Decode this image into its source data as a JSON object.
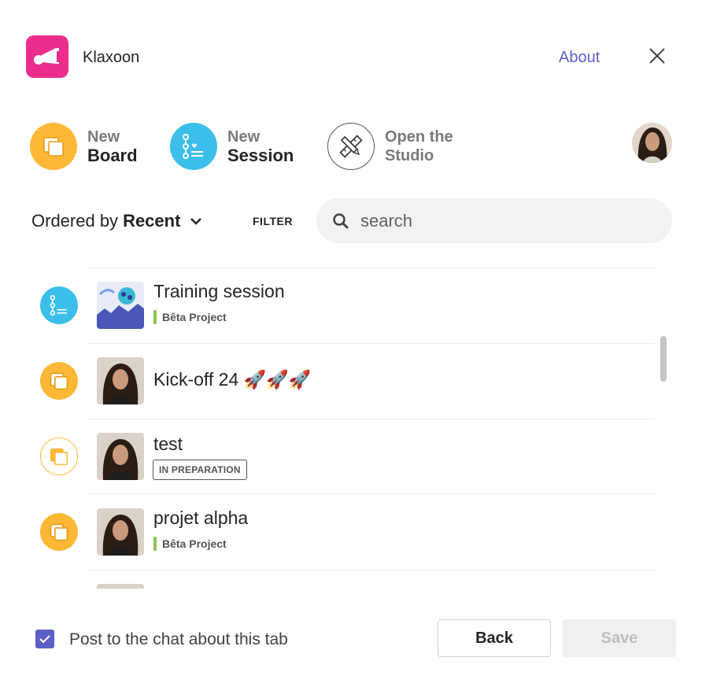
{
  "app": {
    "title": "Klaxoon",
    "about_label": "About",
    "logo_icon": "horn-icon",
    "brand_color": "#ec2d8e"
  },
  "actions": {
    "new_board": {
      "line1": "New",
      "line2": "Board",
      "icon": "board-icon",
      "color": "#ffb836"
    },
    "new_session": {
      "line1": "New",
      "line2": "Session",
      "icon": "session-icon",
      "color": "#3bbfea"
    },
    "studio": {
      "line1": "Open the",
      "line2": "Studio",
      "icon": "ruler-pencil-icon"
    }
  },
  "list_controls": {
    "order_prefix": "Ordered by",
    "order_value": "Recent",
    "filter_label": "FILTER",
    "search_placeholder": "search"
  },
  "items": [
    {
      "type": "session",
      "title": "Training session",
      "tag": "Bêta Project",
      "thumb": "training-image"
    },
    {
      "type": "board",
      "title": "Kick-off 24 🚀🚀🚀",
      "thumb": "user-photo"
    },
    {
      "type": "board-draft",
      "title": "test",
      "status": "IN PREPARATION",
      "thumb": "user-photo"
    },
    {
      "type": "board",
      "title": "projet alpha",
      "tag": "Bêta Project",
      "thumb": "user-photo"
    },
    {
      "type": "board",
      "title": "",
      "thumb": "user-photo"
    }
  ],
  "footer": {
    "checkbox_label": "Post to the chat about this tab",
    "checkbox_checked": true,
    "back_label": "Back",
    "save_label": "Save"
  },
  "colors": {
    "accent": "#5b5fc7",
    "tag_green": "#92c353"
  }
}
